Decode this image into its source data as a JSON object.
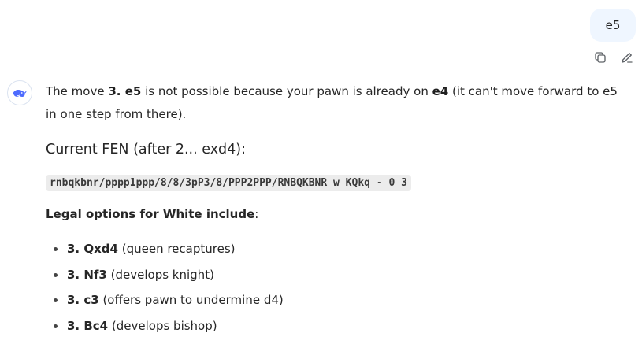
{
  "user_message": {
    "text": "e5"
  },
  "message_actions": [
    {
      "name": "copy-icon"
    },
    {
      "name": "edit-icon"
    }
  ],
  "assistant": {
    "avatar_icon": "whale-logo-icon",
    "intro": {
      "part1": "The move ",
      "move": "3. e5",
      "part2": " is not possible because your pawn is already on ",
      "square": "e4",
      "part3": " (it can't move forward to e5 in one step from there)."
    },
    "fen_heading": "Current FEN (after 2... exd4):",
    "fen": "rnbqkbnr/pppp1ppp/8/8/3pP3/8/PPP2PPP/RNBQKBNR w KQkq - 0 3",
    "legal_label": "Legal options for White include",
    "legal_suffix": ":",
    "options": [
      {
        "move": "3. Qxd4",
        "note": " (queen recaptures)"
      },
      {
        "move": "3. Nf3",
        "note": " (develops knight)"
      },
      {
        "move": "3. c3",
        "note": " (offers pawn to undermine d4)"
      },
      {
        "move": "3. Bc4",
        "note": " (develops bishop)"
      }
    ]
  },
  "colors": {
    "accent": "#4d6bfe",
    "user_bubble": "#eff6ff"
  }
}
